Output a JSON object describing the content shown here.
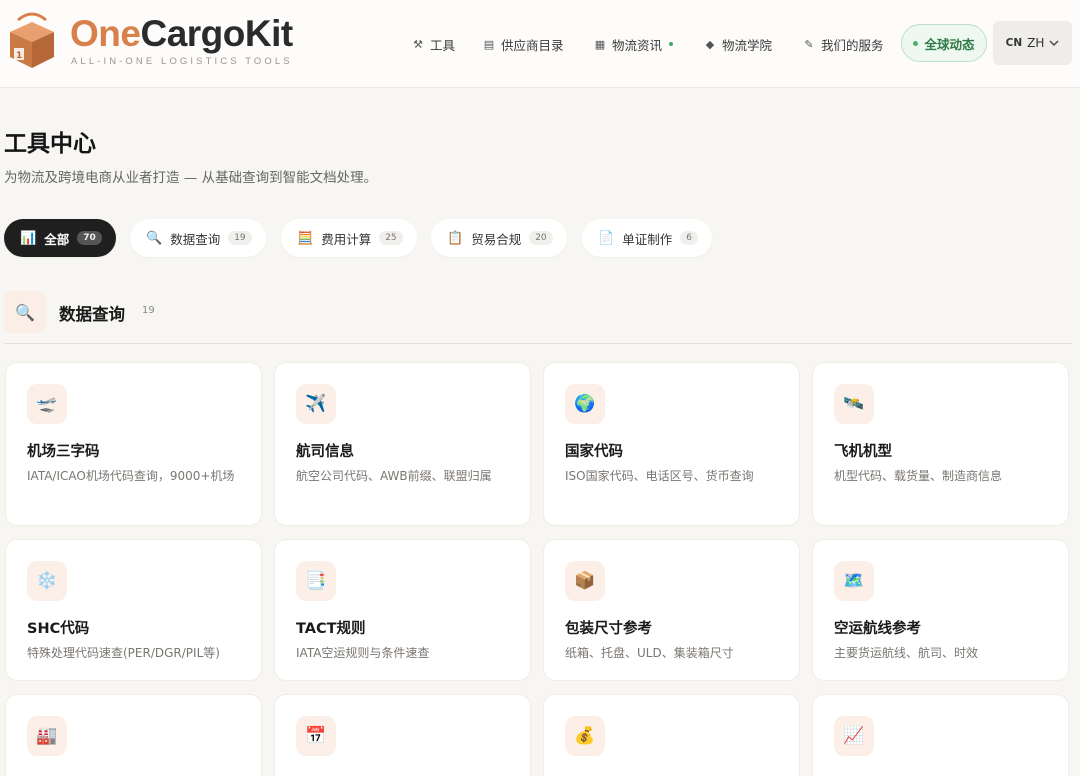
{
  "brand": {
    "name_accent": "One",
    "name_rest": "CargoKit",
    "tagline": "ALL-IN-ONE LOGISTICS TOOLS",
    "accent_color": "#d7804a"
  },
  "nav": {
    "items": [
      {
        "label": "工具",
        "icon": "wrench-icon"
      },
      {
        "label": "供应商目录",
        "icon": "clipboard-icon"
      },
      {
        "label": "物流资讯",
        "icon": "newspaper-icon"
      },
      {
        "label": "物流学院",
        "icon": "graduation-cap-icon"
      },
      {
        "label": "我们的服务",
        "icon": "handshake-icon"
      }
    ],
    "global_news": "全球动态",
    "lang_region": "CN",
    "lang_code": "ZH"
  },
  "page": {
    "title": "工具中心",
    "subtitle": "为物流及跨境电商从业者打造 — 从基础查询到智能文档处理。"
  },
  "tabs": [
    {
      "label": "全部",
      "count": "70",
      "icon": "bar-chart-icon",
      "active": true
    },
    {
      "label": "数据查询",
      "count": "19",
      "icon": "magnifier-icon"
    },
    {
      "label": "费用计算",
      "count": "25",
      "icon": "calculator-icon"
    },
    {
      "label": "贸易合规",
      "count": "20",
      "icon": "clipboard-icon"
    },
    {
      "label": "单证制作",
      "count": "6",
      "icon": "document-icon"
    }
  ],
  "section": {
    "title": "数据查询",
    "count": "19",
    "icon": "magnifier-icon"
  },
  "cards": [
    {
      "title": "机场三字码",
      "desc": "IATA/ICAO机场代码查询，9000+机场",
      "icon": "airport-icon"
    },
    {
      "title": "航司信息",
      "desc": "航空公司代码、AWB前缀、联盟归属",
      "icon": "airplane-icon"
    },
    {
      "title": "国家代码",
      "desc": "ISO国家代码、电话区号、货币查询",
      "icon": "globe-icon"
    },
    {
      "title": "飞机机型",
      "desc": "机型代码、载货量、制造商信息",
      "icon": "satellite-icon"
    },
    {
      "title": "SHC代码",
      "desc": "特殊处理代码速查(PER/DGR/PIL等)",
      "icon": "snowflake-icon"
    },
    {
      "title": "TACT规则",
      "desc": "IATA空运规则与条件速查",
      "icon": "document-icon"
    },
    {
      "title": "包装尺寸参考",
      "desc": "纸箱、托盘、ULD、集装箱尺寸",
      "icon": "package-icon"
    },
    {
      "title": "空运航线参考",
      "desc": "主要货运航线、航司、时效",
      "icon": "map-icon"
    },
    {
      "title": "",
      "desc": "",
      "icon": "factory-icon"
    },
    {
      "title": "",
      "desc": "",
      "icon": "calendar-icon"
    },
    {
      "title": "",
      "desc": "",
      "icon": "money-bag-icon"
    },
    {
      "title": "",
      "desc": "",
      "icon": "line-chart-icon"
    }
  ]
}
